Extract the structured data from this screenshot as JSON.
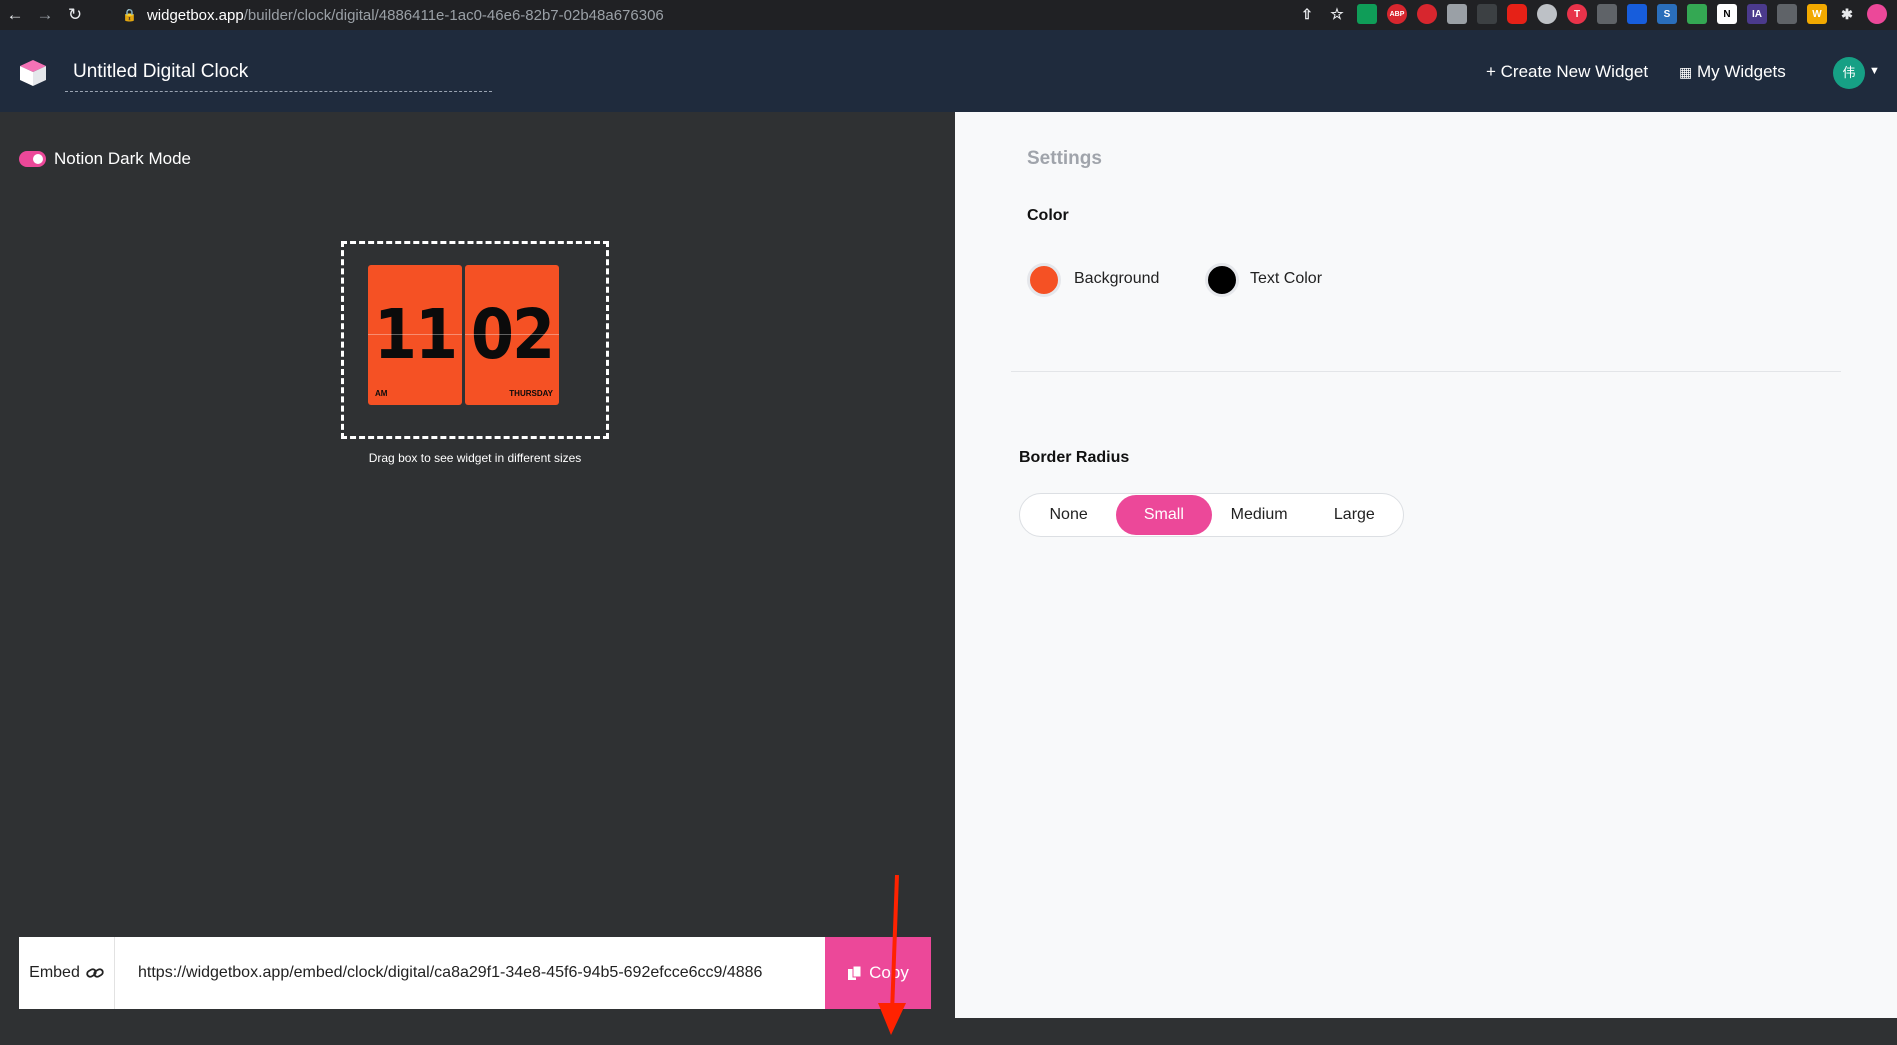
{
  "browser": {
    "url_domain": "widgetbox.app",
    "url_path": "/builder/clock/digital/4886411e-1ac0-46e6-82b7-02b48a676306"
  },
  "header": {
    "widget_title": "Untitled Digital Clock",
    "create_label": "+ Create New Widget",
    "my_widgets_label": "My Widgets",
    "avatar_initial": "伟"
  },
  "preview": {
    "dark_mode_label": "Notion Dark Mode",
    "dark_mode_on": true,
    "clock": {
      "hour": "11",
      "minute": "02",
      "period": "AM",
      "day": "THURSDAY"
    },
    "drag_hint": "Drag box to see widget in different sizes"
  },
  "embed": {
    "label": "Embed",
    "url": "https://widgetbox.app/embed/clock/digital/ca8a29f1-34e8-45f6-94b5-692efcce6cc9/4886",
    "copy_label": "Copy"
  },
  "settings": {
    "title": "Settings",
    "color_title": "Color",
    "background_label": "Background",
    "background_color": "#f55124",
    "text_color_label": "Text Color",
    "text_color": "#000000",
    "border_radius_title": "Border Radius",
    "border_radius_options": [
      "None",
      "Small",
      "Medium",
      "Large"
    ],
    "border_radius_selected": "Small"
  },
  "colors": {
    "accent": "#ec4899",
    "header_bg": "#1f2b3d",
    "preview_bg": "#2f3133",
    "annotation_arrow": "#ff2200"
  }
}
